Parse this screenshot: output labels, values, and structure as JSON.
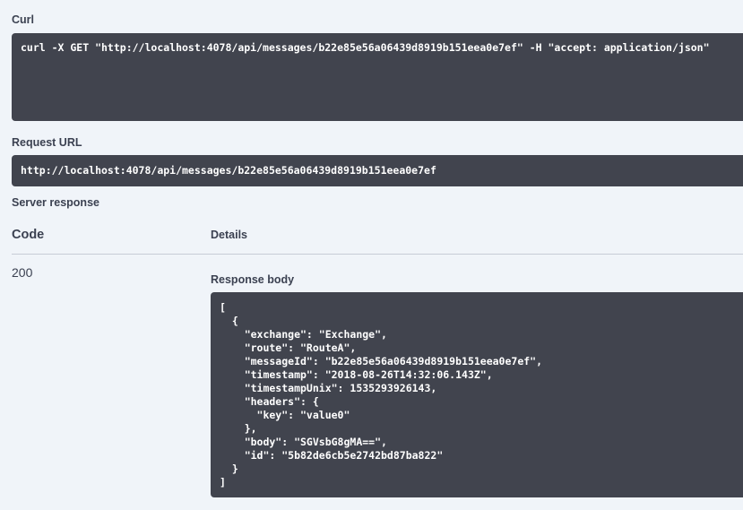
{
  "curl": {
    "label": "Curl",
    "command": "curl -X GET \"http://localhost:4078/api/messages/b22e85e56a06439d8919b151eea0e7ef\" -H \"accept: application/json\""
  },
  "request_url": {
    "label": "Request URL",
    "value": "http://localhost:4078/api/messages/b22e85e56a06439d8919b151eea0e7ef"
  },
  "server_response": {
    "label": "Server response",
    "columns": {
      "code": "Code",
      "details": "Details"
    },
    "status_code": "200",
    "response_body_label": "Response body",
    "response_body_lines": [
      "[",
      "  {",
      "    \"exchange\": \"Exchange\",",
      "    \"route\": \"RouteA\",",
      "    \"messageId\": \"b22e85e56a06439d8919b151eea0e7ef\",",
      "    \"timestamp\": \"2018-08-26T14:32:06.143Z\",",
      "    \"timestampUnix\": 1535293926143,",
      "    \"headers\": {",
      "      \"key\": \"value0\"",
      "    },",
      "    \"body\": \"SGVsbG8gMA==\",",
      "    \"id\": \"5b82de6cb5e2742bd87ba822\"",
      "  }",
      "]"
    ]
  },
  "colors": {
    "page_background": "#f0f4f9",
    "code_background": "#41444e",
    "code_text": "#ffffff",
    "label_text": "#3b4151"
  }
}
